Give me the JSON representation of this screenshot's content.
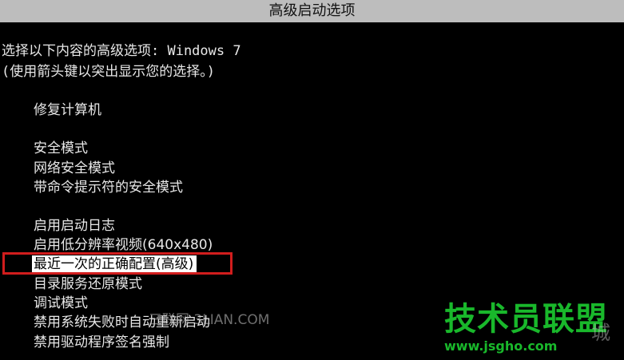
{
  "header": {
    "title": "高级启动选项"
  },
  "instructions": {
    "line1": "选择以下内容的高级选项: Windows 7",
    "line2": "(使用箭头键以突出显示您的选择。)"
  },
  "menu": {
    "items": [
      {
        "label": "修复计算机",
        "selected": false
      },
      {
        "label": "安全模式",
        "selected": false
      },
      {
        "label": "网络安全模式",
        "selected": false
      },
      {
        "label": "带命令提示符的安全模式",
        "selected": false
      },
      {
        "label": "启用启动日志",
        "selected": false
      },
      {
        "label": "启用低分辨率视频(640x480)",
        "selected": false
      },
      {
        "label": "最近一次的正确配置(高级)",
        "selected": true
      },
      {
        "label": "目录服务还原模式",
        "selected": false
      },
      {
        "label": "调试模式",
        "selected": false
      },
      {
        "label": "禁用系统失败时自动重新启动",
        "selected": false
      },
      {
        "label": "禁用驱动程序签名强制",
        "selected": false
      }
    ]
  },
  "watermarks": {
    "left_text": "三联网 3LIAN.COM",
    "logo_text": "技术员联盟",
    "url_text": "www.jsgho.com",
    "city_text": "城"
  },
  "colors": {
    "background": "#000000",
    "header_bar": "#bdbdbd",
    "text": "#e8e8e8",
    "highlight_box": "#d11d1d",
    "watermark_green": "#19b82b"
  }
}
